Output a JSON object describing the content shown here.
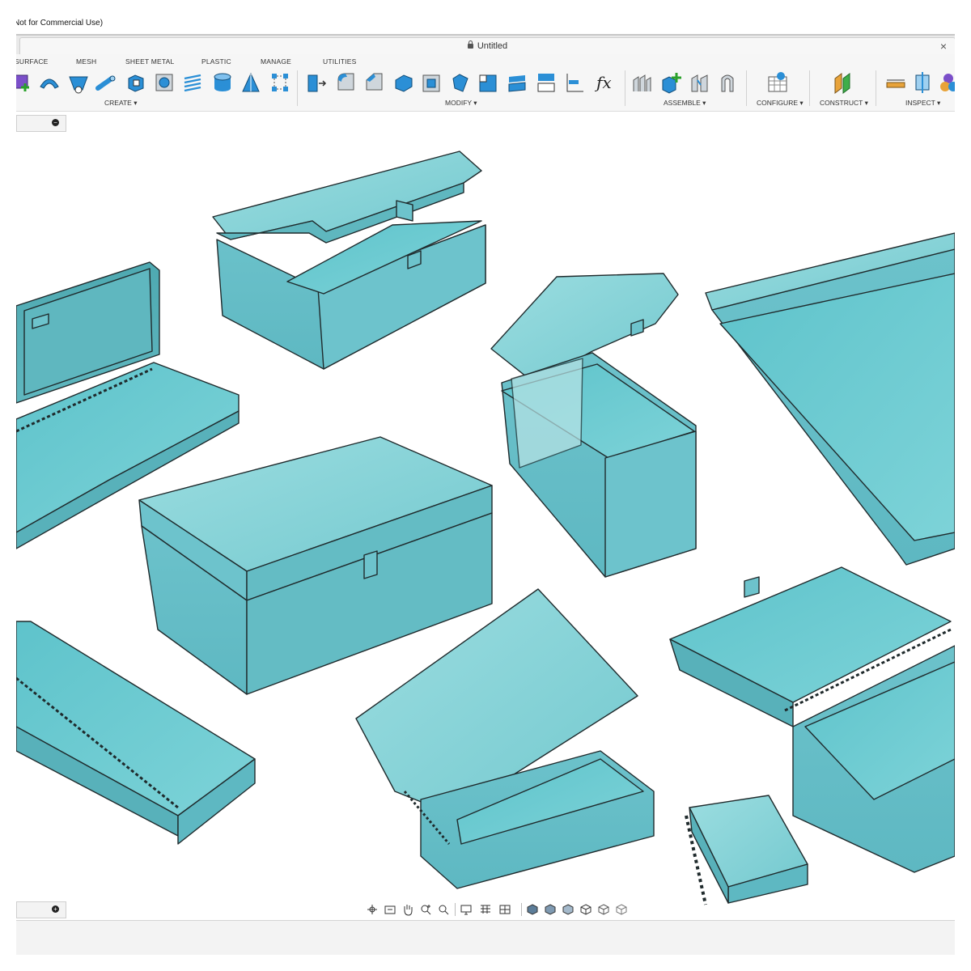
{
  "app": {
    "title_fragment": "Not for Commercial Use)"
  },
  "document": {
    "title": "Untitled",
    "close_glyph": "×"
  },
  "toolbar": {
    "workspace_tabs": [
      "SURFACE",
      "MESH",
      "SHEET METAL",
      "PLASTIC",
      "MANAGE",
      "UTILITIES"
    ],
    "groups": {
      "create": "CREATE ▾",
      "modify": "MODIFY ▾",
      "assemble": "ASSEMBLE ▾",
      "configure": "CONFIGURE ▾",
      "construct": "CONSTRUCT ▾",
      "inspect": "INSPECT ▾"
    },
    "tools": {
      "create": [
        "create-form-icon",
        "sweep-icon",
        "loft-icon",
        "pipe-icon",
        "extrude-icon",
        "hole-icon",
        "thread-icon",
        "cylinder-icon",
        "coil-icon",
        "pattern-icon"
      ],
      "modify": [
        "press-pull-icon",
        "fillet-icon",
        "chamfer-icon",
        "shell-icon",
        "draft-icon",
        "scale-icon",
        "combine-icon",
        "split-body-icon",
        "offset-face-icon",
        "align-icon",
        "parameters-icon"
      ],
      "parameters_glyph": "ƒx",
      "assemble": [
        "new-component-icon",
        "add-component-icon",
        "joint-icon",
        "as-built-joint-icon"
      ],
      "configure": [
        "configure-table-icon"
      ],
      "construct": [
        "offset-plane-icon"
      ],
      "inspect": [
        "measure-icon",
        "section-analysis-icon",
        "appearance-icon"
      ]
    }
  },
  "panels": {
    "browser_toggle": "−",
    "comments_toggle": "+"
  },
  "navbar": {
    "tools": [
      "orbit-icon",
      "look-at-icon",
      "pan-icon",
      "zoom-window-icon",
      "zoom-icon",
      "display-settings-icon",
      "grid-icon",
      "viewports-icon",
      "view-front-icon",
      "view-top-icon",
      "view-right-icon",
      "view-iso-icon",
      "view-left-icon",
      "view-back-icon"
    ]
  },
  "viewport": {
    "model_color": "#6cc4cc",
    "model_top_color": "#86d3d8",
    "model_dark_color": "#4ea9b1",
    "edge_color": "#1f2a2c",
    "shadow_color": "#e3e3e3"
  }
}
